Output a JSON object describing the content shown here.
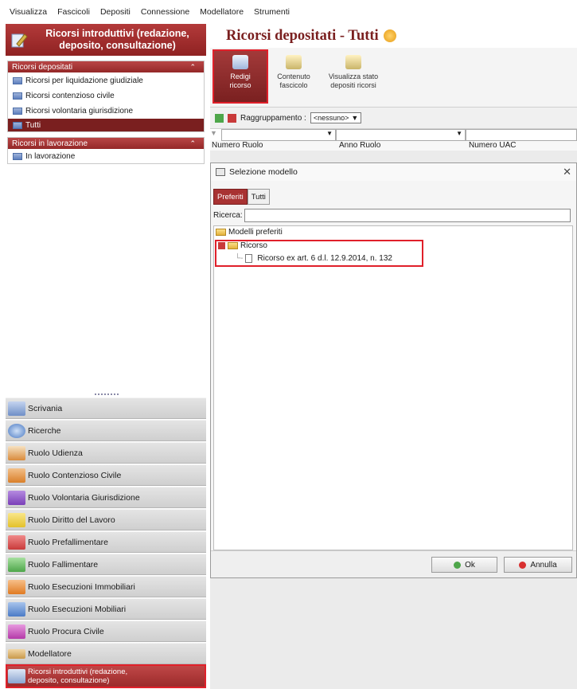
{
  "menu": [
    "Visualizza",
    "Fascicoli",
    "Depositi",
    "Connessione",
    "Modellatore",
    "Strumenti"
  ],
  "left": {
    "header": "Ricorsi introduttivi (redazione, deposito, consultazione)",
    "sections": [
      {
        "title": "Ricorsi depositati",
        "items": [
          "Ricorsi per liquidazione giudiziale",
          "Ricorsi contenzioso civile",
          "Ricorsi volontaria giurisdizione",
          "Tutti"
        ]
      },
      {
        "title": "Ricorsi in lavorazione",
        "items": [
          "In lavorazione"
        ]
      }
    ],
    "nav": [
      "Scrivania",
      "Ricerche",
      "Ruolo Udienza",
      "Ruolo Contenzioso Civile",
      "Ruolo Volontaria Giurisdizione",
      "Ruolo Diritto del Lavoro",
      "Ruolo Prefallimentare",
      "Ruolo Fallimentare",
      "Ruolo Esecuzioni Immobiliari",
      "Ruolo Esecuzioni Mobiliari",
      "Ruolo Procura Civile",
      "Modellatore",
      "Ricorsi introduttivi (redazione, deposito, consultazione)"
    ]
  },
  "main": {
    "title": "Ricorsi depositati - Tutti",
    "ribbon": [
      "Redigi ricorso",
      "Contenuto fascicolo",
      "Visualizza stato depositi ricorsi"
    ],
    "grouping_label": "Raggruppamento :",
    "grouping_value": "<nessuno>",
    "columns": [
      "Numero Ruolo",
      "Anno Ruolo",
      "Numero UAC"
    ]
  },
  "dialog": {
    "title": "Selezione modello",
    "tabs": [
      "Preferiti",
      "Tutti"
    ],
    "search_label": "Ricerca:",
    "search_value": "",
    "tree_root": "Modelli preferiti",
    "tree_folder": "Ricorso",
    "tree_doc": "Ricorso ex art. 6 d.l. 12.9.2014, n. 132",
    "ok": "Ok",
    "cancel": "Annulla"
  },
  "colors": {
    "accent": "#8f2222",
    "highlight": "#e0202a"
  }
}
